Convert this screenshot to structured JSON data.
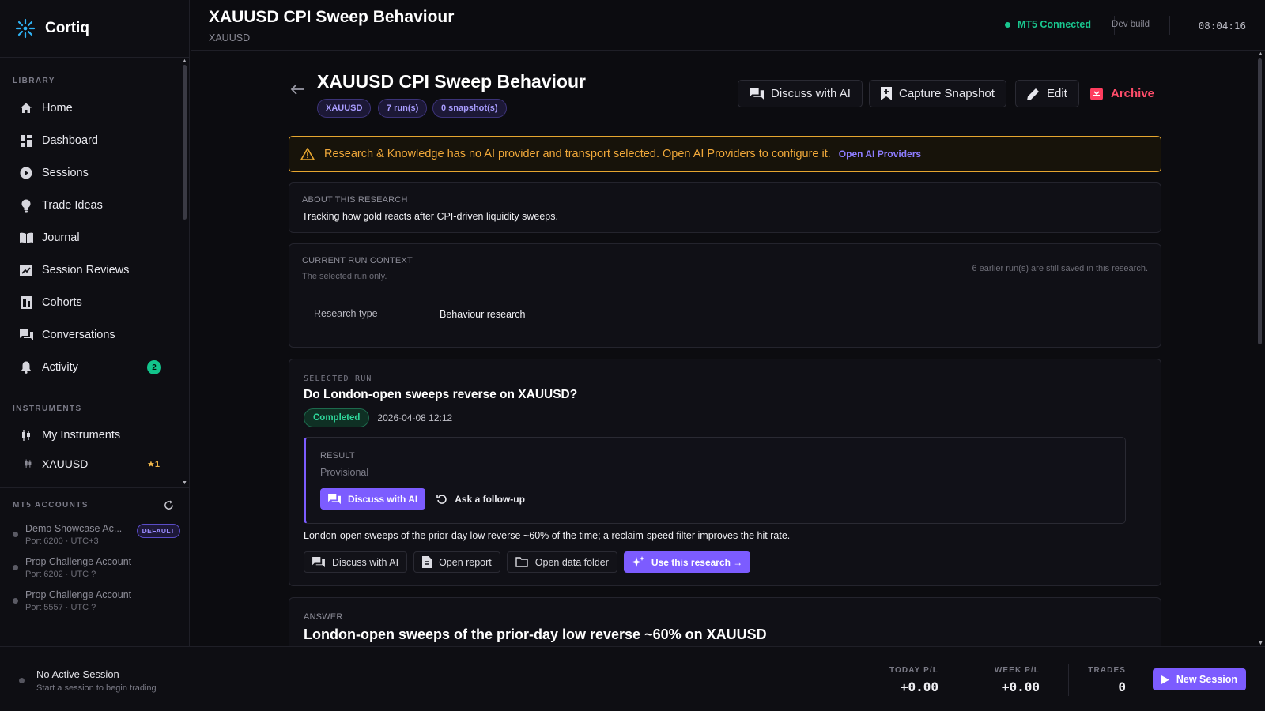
{
  "app": {
    "name": "Cortiq"
  },
  "sidebar": {
    "library_label": "LIBRARY",
    "items": [
      {
        "label": "Home",
        "icon": "home-icon"
      },
      {
        "label": "Dashboard",
        "icon": "dashboard-icon"
      },
      {
        "label": "Sessions",
        "icon": "play-circle-icon"
      },
      {
        "label": "Trade Ideas",
        "icon": "lightbulb-icon"
      },
      {
        "label": "Journal",
        "icon": "book-icon"
      },
      {
        "label": "Session Reviews",
        "icon": "review-icon"
      },
      {
        "label": "Cohorts",
        "icon": "cohorts-icon"
      },
      {
        "label": "Conversations",
        "icon": "chat-icon"
      },
      {
        "label": "Activity",
        "icon": "bell-icon",
        "badge": "2"
      }
    ],
    "instruments_label": "INSTRUMENTS",
    "my_instruments": "My Instruments",
    "instrument": {
      "label": "XAUUSD",
      "badge": "★1"
    }
  },
  "mt5": {
    "label": "MT5 ACCOUNTS",
    "accounts": [
      {
        "name": "Demo Showcase Ac...",
        "sub": "Port 6200 · UTC+3",
        "pill": "DEFAULT"
      },
      {
        "name": "Prop Challenge Account",
        "sub": "Port 6202 · UTC ?"
      },
      {
        "name": "Prop Challenge Account",
        "sub": "Port 5557 · UTC ?"
      }
    ]
  },
  "topbar": {
    "title": "XAUUSD CPI Sweep Behaviour",
    "subtitle": "XAUUSD",
    "status": "MT5 Connected",
    "build": "Dev build",
    "clock": "08:04:16"
  },
  "page": {
    "title": "XAUUSD CPI Sweep Behaviour",
    "chips": [
      "XAUUSD",
      "7 run(s)",
      "0 snapshot(s)"
    ],
    "actions": {
      "discuss": "Discuss with AI",
      "snapshot": "Capture Snapshot",
      "edit": "Edit",
      "archive": "Archive"
    }
  },
  "warning": {
    "message": "Research & Knowledge has no AI provider and transport selected. Open AI Providers to configure it.",
    "link": "Open AI Providers"
  },
  "about": {
    "caption": "ABOUT THIS RESEARCH",
    "text": "Tracking how gold reacts after CPI-driven liquidity sweeps."
  },
  "context": {
    "caption": "CURRENT RUN CONTEXT",
    "sub": "The selected run only.",
    "note": "6 earlier run(s) are still saved in this research.",
    "type_label": "Research type",
    "type_value": "Behaviour research"
  },
  "run": {
    "caption": "SELECTED RUN",
    "question": "Do London-open sweeps reverse on XAUUSD?",
    "status": "Completed",
    "timestamp": "2026-04-08 12:12",
    "result_caption": "RESULT",
    "result_state": "Provisional",
    "discuss": "Discuss with AI",
    "followup": "Ask a follow-up",
    "summary": "London-open sweeps of the prior-day low reverse ~60% of the time; a reclaim-speed filter improves the hit rate.",
    "buttons": {
      "discuss": "Discuss with AI",
      "report": "Open report",
      "folder": "Open data folder",
      "use": "Use this research →"
    }
  },
  "answer": {
    "caption": "ANSWER",
    "title": "London-open sweeps of the prior-day low reverse ~60% on XAUUSD"
  },
  "footer": {
    "title": "No Active Session",
    "sub": "Start a session to begin trading",
    "today_label": "TODAY P/L",
    "today_value": "+0.00",
    "week_label": "WEEK P/L",
    "week_value": "+0.00",
    "trades_label": "TRADES",
    "trades_value": "0",
    "new_session": "New Session"
  },
  "colors": {
    "accent": "#7c5cff",
    "success": "#19c78f",
    "warning": "#e6a630",
    "danger": "#ff4d6a"
  }
}
